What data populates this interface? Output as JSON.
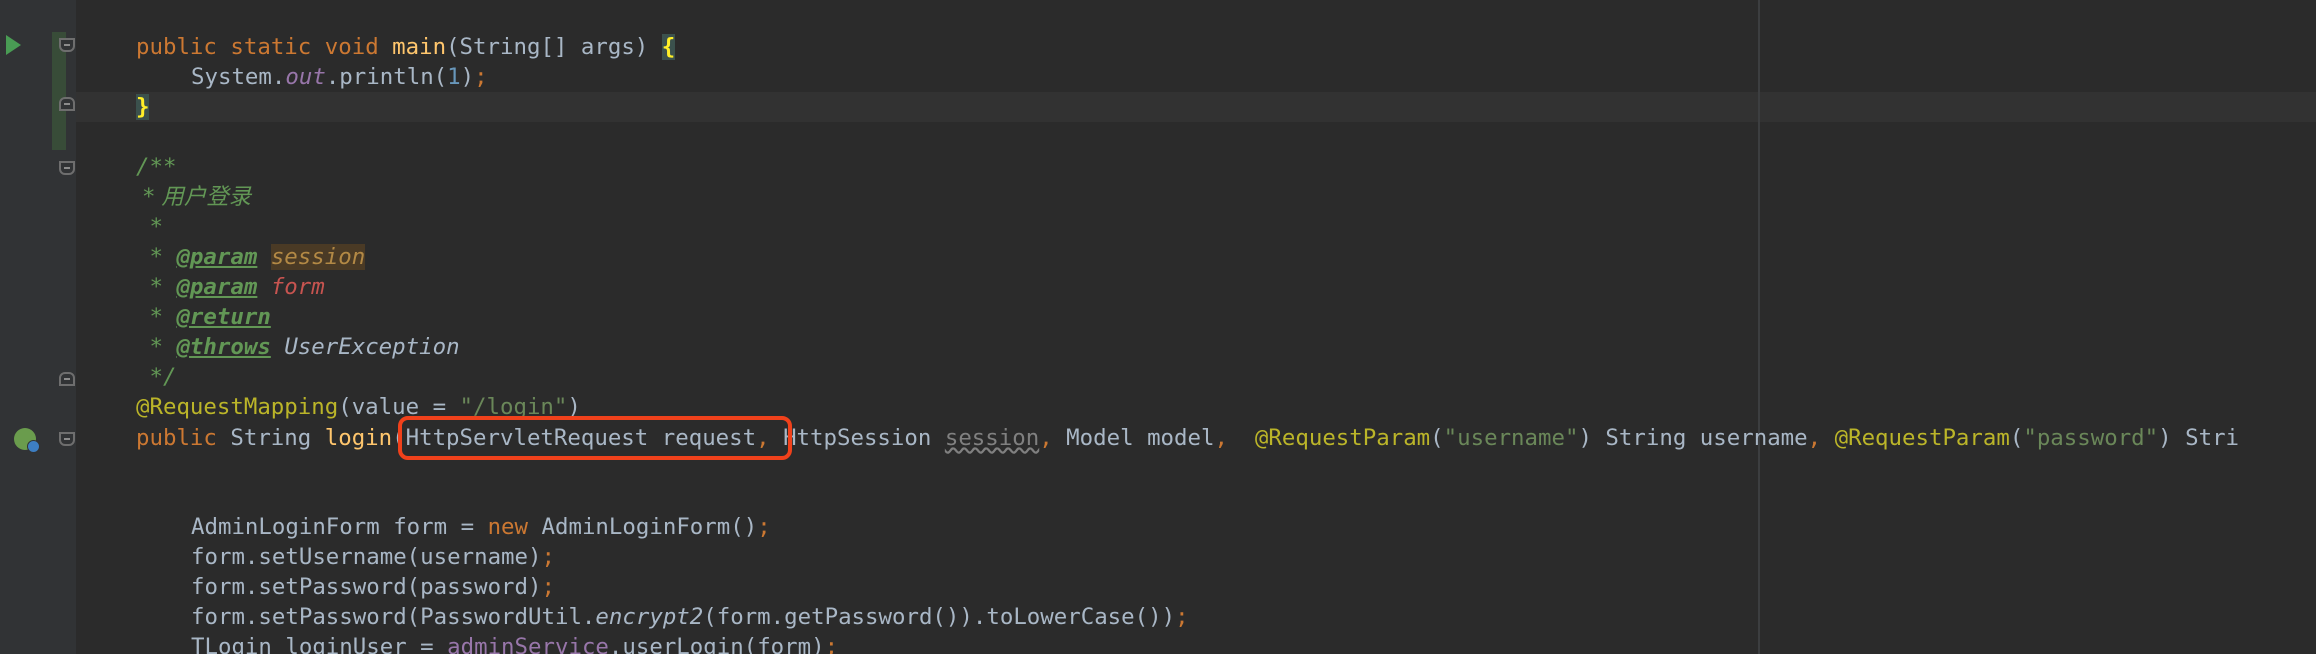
{
  "editor": {
    "lines": {
      "l1": {
        "pub": "public",
        "sta": "static",
        "voi": "void",
        "name": "main",
        "params": "(String[] args) ",
        "brace": "{"
      },
      "l2": {
        "pre": "System.",
        "field": "out",
        "call": ".println(",
        "num": "1",
        "post": ")",
        "semi": ";"
      },
      "l3": {
        "brace": "}"
      },
      "l5": {
        "text": "/**"
      },
      "l6": {
        "text": " * 用户登录"
      },
      "l7": {
        "text": " *"
      },
      "l8": {
        "star": " * ",
        "tag": "@param",
        "sp": " ",
        "param": "session"
      },
      "l9": {
        "star": " * ",
        "tag": "@param",
        "sp": " ",
        "param": "form"
      },
      "l10": {
        "star": " * ",
        "tag": "@return"
      },
      "l11": {
        "star": " * ",
        "tag": "@throws",
        "sp": " ",
        "ref": "UserException"
      },
      "l12": {
        "text": " */"
      },
      "l13": {
        "ann": "@RequestMapping",
        "open": "(value = ",
        "str": "\"/login\"",
        "close": ")"
      },
      "l14": {
        "pub": "public",
        "type": " String ",
        "name": "login",
        "p1": "(HttpServletRequest request",
        "c1": ",",
        "p2a": " HttpSession ",
        "p2b": "session",
        "c2": ",",
        "p3": " Model model",
        "c3": ",",
        "sp3": "  ",
        "ann1": "@RequestParam",
        "o1": "(",
        "s1": "\"username\"",
        "t1": ") String username",
        "c4": ",",
        "sp4": " ",
        "ann2": "@RequestParam",
        "o2": "(",
        "s2": "\"password\"",
        "t2": ") Stri"
      },
      "l17": {
        "pre": "AdminLoginForm form = ",
        "kw": "new",
        "post": " AdminLoginForm()",
        "semi": ";"
      },
      "l18": {
        "text": "form.setUsername(username)",
        "semi": ";"
      },
      "l19": {
        "text": "form.setPassword(password)",
        "semi": ";"
      },
      "l20": {
        "pre": "form.setPassword(PasswordUtil.",
        "static": "encrypt2",
        "post": "(form.getPassword()).toLowerCase())",
        "semi": ";"
      },
      "l21": {
        "pre": "TLogin loginUser = ",
        "inst": "adminService",
        "post": ".userLogin(form)",
        "semi": ";"
      }
    }
  },
  "gutter_icons": [
    "run-icon",
    "fold-icon",
    "spring-bean-icon"
  ],
  "colors": {
    "background": "#2b2b2b",
    "keyword": "#cc7832",
    "method": "#ffc66d",
    "string": "#6a8759",
    "annotation": "#bbb529",
    "highlight_box": "#f0411b"
  }
}
